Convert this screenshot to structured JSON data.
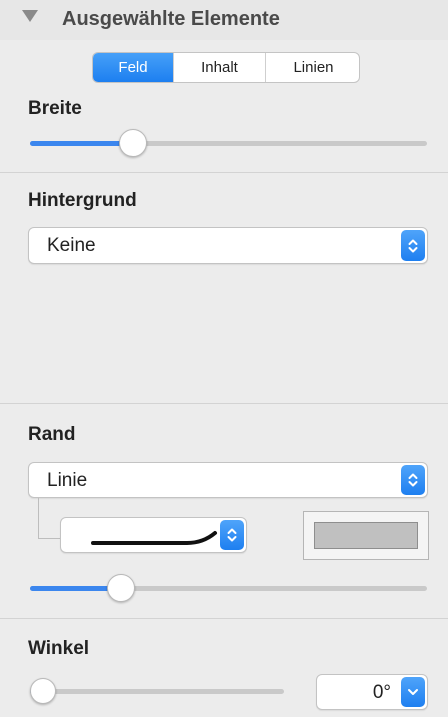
{
  "panel": {
    "title": "Ausgewählte Elemente",
    "tabs": [
      {
        "label": "Feld",
        "active": true
      },
      {
        "label": "Inhalt",
        "active": false
      },
      {
        "label": "Linien",
        "active": false
      }
    ]
  },
  "breite": {
    "label": "Breite",
    "slider_value": 0.24
  },
  "hintergrund": {
    "label": "Hintergrund",
    "selected": "Keine"
  },
  "rand": {
    "label": "Rand",
    "selected": "Linie",
    "line_style_icon": "curved-line-icon",
    "color": "#c0c0c0",
    "slider_value": 0.21
  },
  "winkel": {
    "label": "Winkel",
    "value": "0°",
    "slider_value": 0.0
  },
  "colors": {
    "accent": "#1d7ff0",
    "track": "#c9c9c9",
    "background": "#ececec"
  }
}
